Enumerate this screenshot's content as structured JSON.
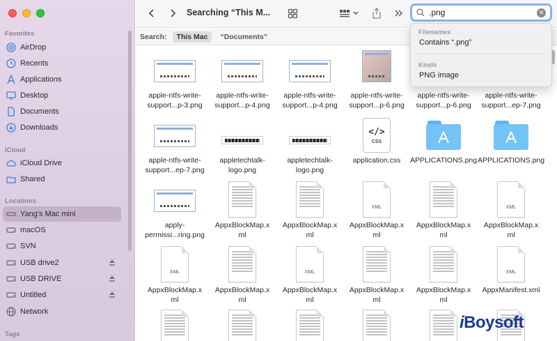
{
  "sidebar": {
    "favorites_header": "Favorites",
    "favorites": [
      {
        "label": "AirDrop",
        "icon": "airdrop-icon"
      },
      {
        "label": "Recents",
        "icon": "clock-icon"
      },
      {
        "label": "Applications",
        "icon": "applications-icon"
      },
      {
        "label": "Desktop",
        "icon": "desktop-icon"
      },
      {
        "label": "Documents",
        "icon": "document-icon"
      },
      {
        "label": "Downloads",
        "icon": "download-icon"
      }
    ],
    "icloud_header": "iCloud",
    "icloud": [
      {
        "label": "iCloud Drive",
        "icon": "cloud-icon"
      },
      {
        "label": "Shared",
        "icon": "shared-folder-icon"
      }
    ],
    "locations_header": "Locations",
    "locations": [
      {
        "label": "Yang's Mac mini",
        "icon": "computer-icon",
        "selected": true
      },
      {
        "label": "macOS",
        "icon": "drive-icon"
      },
      {
        "label": "SVN",
        "icon": "drive-icon"
      },
      {
        "label": "USB drive2",
        "icon": "drive-icon",
        "eject": true
      },
      {
        "label": "USB DRIVE",
        "icon": "drive-icon",
        "eject": true
      },
      {
        "label": "Untitled",
        "icon": "drive-icon",
        "eject": true
      },
      {
        "label": "Network",
        "icon": "globe-icon"
      }
    ],
    "tags_header": "Tags"
  },
  "toolbar": {
    "title": "Searching “This M...",
    "search_value": ".png"
  },
  "scope": {
    "label": "Search:",
    "this_mac": "This Mac",
    "documents": "“Documents”"
  },
  "dropdown": {
    "filenames_header": "Filenames",
    "filenames_item": "Contains “.png”",
    "kinds_header": "Kinds",
    "kinds_item": "PNG image"
  },
  "files": {
    "row1": [
      "apple-ntfs-write-support...p-3.png",
      "apple-ntfs-write-support...p-4.png",
      "apple-ntfs-write-support...p-4.png",
      "apple-ntfs-write-support...p-6.png",
      "apple-ntfs-write-support...p-6.png",
      "apple-ntfs-write-support...ep-7.png"
    ],
    "row2": [
      "apple-ntfs-write-support...ep-7.png",
      "appletechtalk-logo.png",
      "appletechtalk-logo.png",
      "application.css",
      "APPLICATIONS.png",
      "APPLICATIONS.png"
    ],
    "row3": [
      "apply-permissi...ring.png",
      "AppxBlockMap.xml",
      "AppxBlockMap.xml",
      "AppxBlockMap.xml",
      "AppxBlockMap.xml",
      "AppxBlockMap.xml"
    ],
    "row4": [
      "AppxBlockMap.xml",
      "AppxBlockMap.xml",
      "AppxBlockMap.xml",
      "AppxBlockMap.xml",
      "AppxBlockMap.xml",
      "AppxManifest.xml"
    ]
  },
  "labels": {
    "r1": [
      [
        "apple-ntfs-write-",
        "support...p-3.png"
      ],
      [
        "apple-ntfs-write-",
        "support...p-4.png"
      ],
      [
        "apple-ntfs-write-",
        "support...p-4.png"
      ],
      [
        "apple-ntfs-write-",
        "support...p-6.png"
      ],
      [
        "apple-ntfs-write-",
        "support...p-6.png"
      ],
      [
        "apple-ntfs-write-",
        "support...ep-7.png"
      ]
    ],
    "r2": [
      [
        "apple-ntfs-write-",
        "support...ep-7.png"
      ],
      [
        "appletechtalk-",
        "logo.png"
      ],
      [
        "appletechtalk-",
        "logo.png"
      ],
      [
        "application.css",
        ""
      ],
      [
        "APPLICATIONS.png",
        ""
      ],
      [
        "APPLICATIONS.png",
        ""
      ]
    ],
    "r3": [
      [
        "apply-",
        "permissi...ring.png"
      ],
      [
        "AppxBlockMap.x",
        "ml"
      ],
      [
        "AppxBlockMap.x",
        "ml"
      ],
      [
        "AppxBlockMap.x",
        "ml"
      ],
      [
        "AppxBlockMap.x",
        "ml"
      ],
      [
        "AppxBlockMap.x",
        "ml"
      ]
    ],
    "r4": [
      [
        "AppxBlockMap.x",
        "ml"
      ],
      [
        "AppxBlockMap.x",
        "ml"
      ],
      [
        "AppxBlockMap.x",
        "ml"
      ],
      [
        "AppxBlockMap.x",
        "ml"
      ],
      [
        "AppxBlockMap.x",
        "ml"
      ],
      [
        "AppxManifest.xml",
        ""
      ]
    ]
  },
  "xml_ext": "XML",
  "css_ext": "CSS",
  "css_code": "</>",
  "watermark": {
    "prefix": "i",
    "name": "Boysoft"
  },
  "colors": {
    "accent": "#8ab3e8",
    "folder": "#74c3f5",
    "selected": "#c8b9cd"
  }
}
